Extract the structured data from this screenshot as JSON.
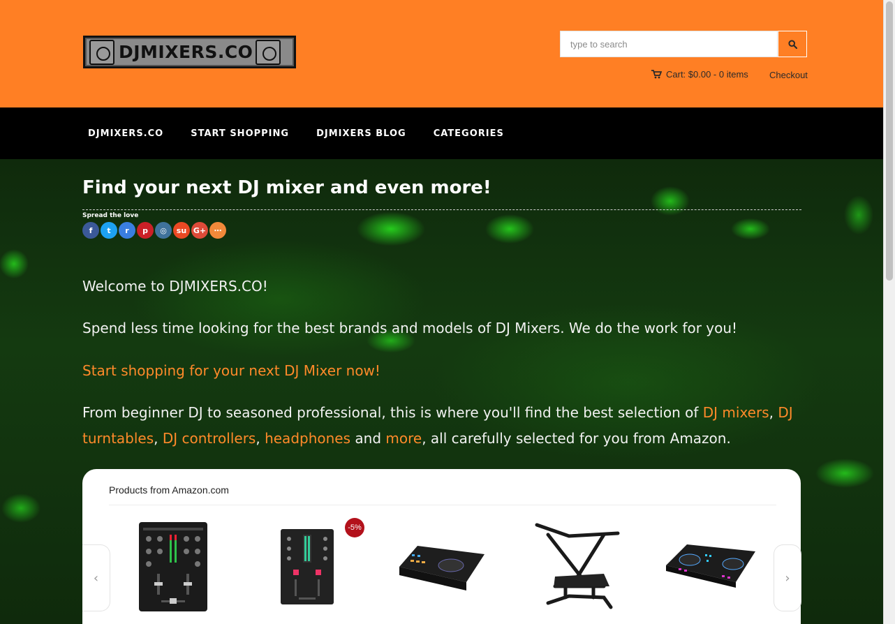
{
  "brand": {
    "name": "DJMIXERS.CO"
  },
  "search": {
    "placeholder": "type to search"
  },
  "header": {
    "cart_label": "Cart: $0.00 - 0 items",
    "checkout_label": "Checkout"
  },
  "nav": {
    "items": [
      {
        "label": "DJMIXERS.CO"
      },
      {
        "label": "START SHOPPING"
      },
      {
        "label": "DJMIXERS BLOG"
      },
      {
        "label": "CATEGORIES"
      }
    ]
  },
  "main": {
    "title": "Find your next DJ mixer and even more!",
    "spread_label": "Spread the love",
    "share_icons": [
      "facebook-icon",
      "twitter-icon",
      "reddit-icon",
      "pinterest-icon",
      "instagram-icon",
      "stumbleupon-icon",
      "google-plus-icon",
      "more-share-icon"
    ],
    "welcome": "Welcome to DJMIXERS.CO!",
    "intro": "Spend less time looking for the best brands and models of DJ Mixers. We do the work for you!",
    "cta_link": "Start shopping for your next DJ Mixer now!",
    "desc": {
      "t1": "From beginner DJ to seasoned professional, this is where you'll find the best selection of ",
      "l1": "DJ mixers",
      "s1": ", ",
      "l2": "DJ turntables",
      "s2": ", ",
      "l3": "DJ controllers",
      "s3": ", ",
      "l4": "headphones",
      "s4": " and ",
      "l5": "more",
      "t2": ", all carefully selected for you from Amazon."
    }
  },
  "products": {
    "heading": "Products from Amazon.com",
    "discount_badge": "-5%",
    "prev": "‹",
    "next": "›"
  },
  "colors": {
    "brand_orange": "#ff7f24",
    "nav_bg": "#000000",
    "link_orange": "#ff8a2a",
    "badge_red": "#b3111b"
  }
}
